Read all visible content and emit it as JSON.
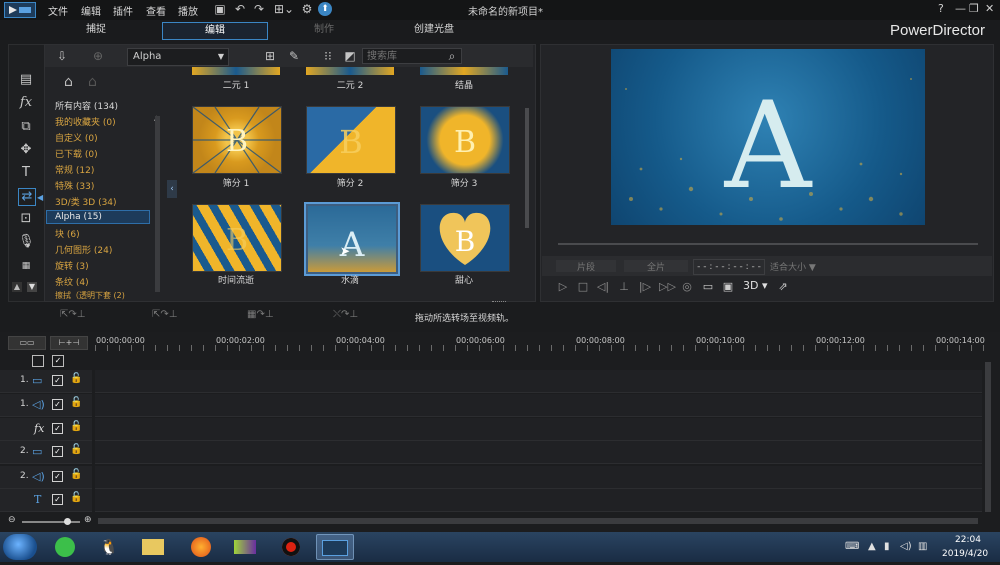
{
  "menubar": {
    "items": [
      "文件",
      "编辑",
      "插件",
      "查看",
      "播放"
    ],
    "app_title": "未命名的新项目*",
    "window_buttons": [
      "?",
      "—",
      "❐",
      "✕"
    ]
  },
  "modes": {
    "capture": "捕捉",
    "edit": "编辑",
    "produce": "制作",
    "disc": "创建光盘",
    "brand": "PowerDirector"
  },
  "library": {
    "filter_selected": "Alpha",
    "search_placeholder": "搜索库",
    "categories": [
      "所有内容 (134)",
      "我的收藏夹 (0)",
      "自定义 (0)",
      "已下载 (0)",
      "常规 (12)",
      "特殊 (33)",
      "3D/类 3D (34)",
      "Alpha (15)",
      "块 (6)",
      "几何图形 (24)",
      "旋转 (3)",
      "条纹 (4)",
      "擦拭（透明下套 (2)"
    ],
    "top_row_labels": [
      "二元 1",
      "二元 2",
      "结晶"
    ],
    "transitions": [
      {
        "label": "筛分 1",
        "glyph": "B",
        "style": "radial"
      },
      {
        "label": "筛分 2",
        "glyph": "B",
        "style": "diagonal"
      },
      {
        "label": "筛分 3",
        "glyph": "B",
        "style": "splash"
      },
      {
        "label": "时间流逝",
        "glyph": "B",
        "style": "drops"
      },
      {
        "label": "水滴",
        "glyph": "A",
        "style": "water",
        "selected": true
      },
      {
        "label": "甜心",
        "glyph": "B",
        "style": "heart"
      }
    ]
  },
  "preview": {
    "glyph": "A",
    "btn_clip": "片段",
    "btn_movie": "全片",
    "timecode": "- - : - - : - - : - -",
    "fit": "适合大小",
    "mode_3d": "3D"
  },
  "action_row": {
    "hint": "拖动所选转场至视频轨。"
  },
  "timeline": {
    "ruler": [
      "00:00:00:00",
      "00:00:02:00",
      "00:00:04:00",
      "00:00:06:00",
      "00:00:08:00",
      "00:00:10:00",
      "00:00:12:00",
      "00:00:14:00"
    ],
    "tracks": [
      {
        "num": "1.",
        "icon": "video"
      },
      {
        "num": "1.",
        "icon": "audio"
      },
      {
        "num": "",
        "icon": "fx"
      },
      {
        "num": "2.",
        "icon": "video"
      },
      {
        "num": "2.",
        "icon": "audio"
      },
      {
        "num": "",
        "icon": "title"
      }
    ]
  },
  "taskbar": {
    "time": "22:04",
    "date": "2019/4/20"
  },
  "colors": {
    "accent": "#3b86c4",
    "category_text": "#d8a441",
    "selected_category": "#1d3b5a"
  }
}
